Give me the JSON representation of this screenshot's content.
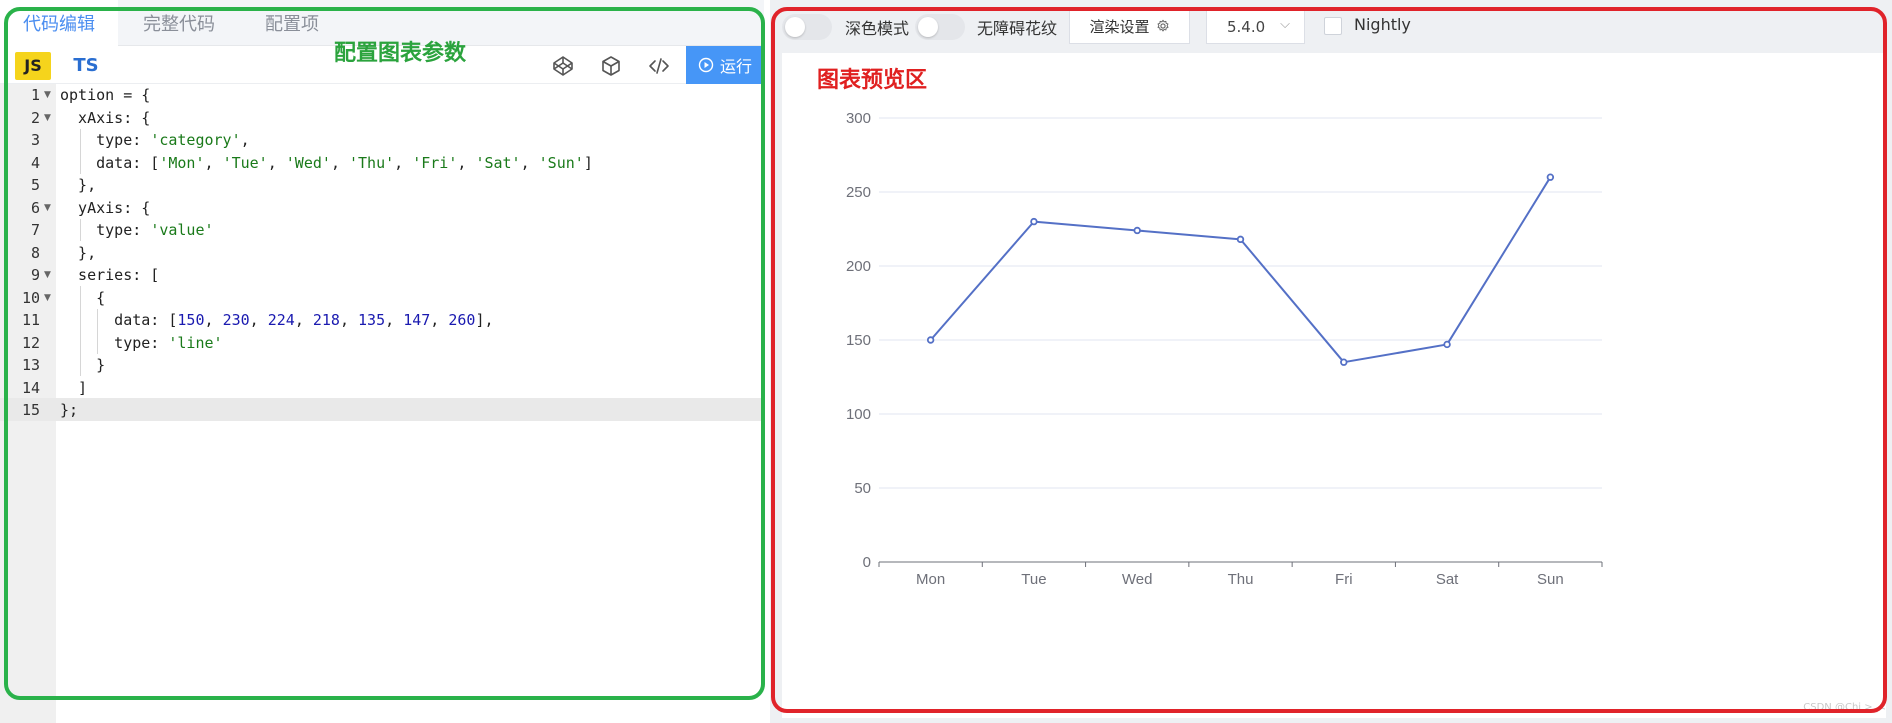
{
  "editor": {
    "tabs": [
      {
        "label": "代码编辑",
        "active": true
      },
      {
        "label": "完整代码",
        "active": false
      },
      {
        "label": "配置项",
        "active": false
      }
    ],
    "lang_js": "JS",
    "lang_ts": "TS",
    "run_label": "运行",
    "annotation": "配置图表参数",
    "line_numbers": [
      "1",
      "2",
      "3",
      "4",
      "5",
      "6",
      "7",
      "8",
      "9",
      "10",
      "11",
      "12",
      "13",
      "14",
      "15"
    ],
    "code": [
      "option = {",
      "  xAxis: {",
      "    type: 'category',",
      "    data: ['Mon', 'Tue', 'Wed', 'Thu', 'Fri', 'Sat', 'Sun']",
      "  },",
      "  yAxis: {",
      "    type: 'value'",
      "  },",
      "  series: [",
      "    {",
      "      data: [150, 230, 224, 218, 135, 147, 260],",
      "      type: 'line'",
      "    }",
      "  ]",
      "};"
    ],
    "icons": [
      "codepen-icon",
      "cube-icon",
      "code-icon",
      "play-circle-icon"
    ]
  },
  "preview": {
    "dark_mode_label": "深色模式",
    "a11y_label": "无障碍花纹",
    "render_settings_label": "渲染设置",
    "version": "5.4.0",
    "nightly_label": "Nightly",
    "annotation": "图表预览区",
    "watermark": "CSDN @Chi >_<"
  },
  "colors": {
    "accent": "#4696f7",
    "series": "#5470c6",
    "left_frame": "#2ab24a",
    "right_frame": "#e0232a",
    "annotation_green": "#2ba33d",
    "annotation_red": "#e02020"
  },
  "chart_data": {
    "type": "line",
    "categories": [
      "Mon",
      "Tue",
      "Wed",
      "Thu",
      "Fri",
      "Sat",
      "Sun"
    ],
    "series": [
      {
        "values": [
          150,
          230,
          224,
          218,
          135,
          147,
          260
        ]
      }
    ],
    "yticks": [
      0,
      50,
      100,
      150,
      200,
      250,
      300
    ],
    "ylim": [
      0,
      300
    ],
    "grid": true,
    "legend": "none"
  }
}
